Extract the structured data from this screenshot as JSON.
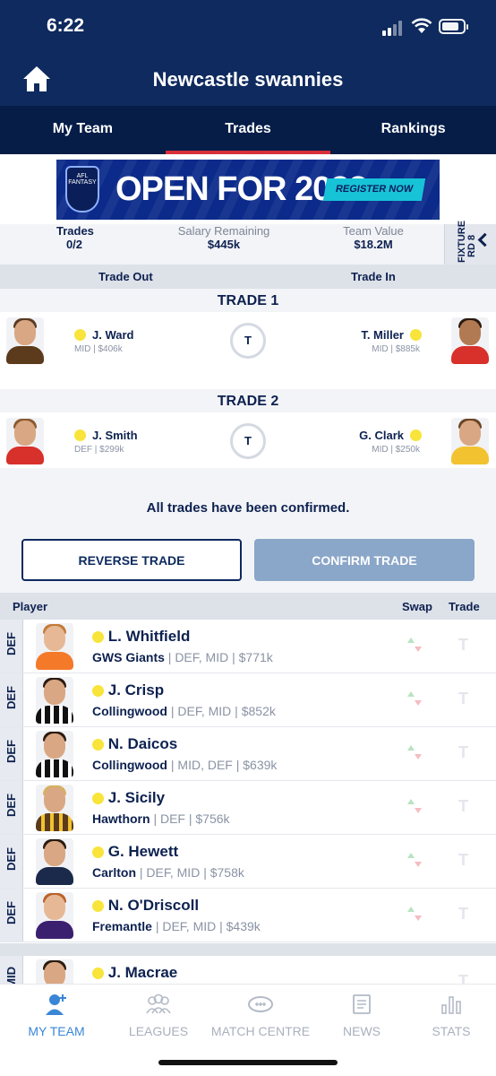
{
  "status_bar": {
    "time": "6:22"
  },
  "header": {
    "title": "Newcastle swannies"
  },
  "tabs": [
    {
      "label": "My Team"
    },
    {
      "label": "Trades"
    },
    {
      "label": "Rankings"
    }
  ],
  "banner": {
    "badge": "AFL FANTASY",
    "headline": "OPEN FOR 2022",
    "cta": "REGISTER NOW"
  },
  "summary": {
    "trades_label": "Trades",
    "trades_value": "0/2",
    "salary_label": "Salary Remaining",
    "salary_value": "$445k",
    "team_value_label": "Team Value",
    "team_value": "$18.2M",
    "fixture_label": "FIXTURE RD 8"
  },
  "trade_header": {
    "out": "Trade Out",
    "in": "Trade In"
  },
  "trades": [
    {
      "label": "TRADE 1",
      "out": {
        "name": "J. Ward",
        "meta": "MID | $406k"
      },
      "swap_label": "T",
      "in": {
        "name": "T. Miller",
        "meta": "MID | $885k"
      }
    },
    {
      "label": "TRADE 2",
      "out": {
        "name": "J. Smith",
        "meta": "DEF | $299k"
      },
      "swap_label": "T",
      "in": {
        "name": "G. Clark",
        "meta": "MID | $250k"
      }
    }
  ],
  "confirm_message": "All trades have been confirmed.",
  "buttons": {
    "reverse": "REVERSE TRADE",
    "confirm": "CONFIRM TRADE"
  },
  "list_header": {
    "player": "Player",
    "swap": "Swap",
    "trade": "Trade"
  },
  "players": [
    {
      "pos": "DEF",
      "name": "L. Whitfield",
      "team": "GWS Giants",
      "detail": "| DEF, MID | $771k",
      "trade": "T"
    },
    {
      "pos": "DEF",
      "name": "J. Crisp",
      "team": "Collingwood",
      "detail": "| DEF, MID | $852k",
      "trade": "T"
    },
    {
      "pos": "DEF",
      "name": "N. Daicos",
      "team": "Collingwood",
      "detail": "| MID, DEF | $639k",
      "trade": "T"
    },
    {
      "pos": "DEF",
      "name": "J. Sicily",
      "team": "Hawthorn",
      "detail": "| DEF | $756k",
      "trade": "T"
    },
    {
      "pos": "DEF",
      "name": "G. Hewett",
      "team": "Carlton",
      "detail": "| DEF, MID | $758k",
      "trade": "T"
    },
    {
      "pos": "DEF",
      "name": "N. O'Driscoll",
      "team": "Fremantle",
      "detail": "| DEF, MID | $439k",
      "trade": "T"
    },
    {
      "pos": "MID",
      "name": "J. Macrae",
      "team": "",
      "detail": "",
      "trade": "T"
    }
  ],
  "bottom_nav": [
    {
      "label": "MY TEAM",
      "icon": "user-plus-icon"
    },
    {
      "label": "LEAGUES",
      "icon": "group-icon"
    },
    {
      "label": "MATCH CENTRE",
      "icon": "football-icon"
    },
    {
      "label": "NEWS",
      "icon": "news-icon"
    },
    {
      "label": "STATS",
      "icon": "bar-chart-icon"
    }
  ],
  "colors": {
    "navy": "#0e2a5e",
    "accent_red": "#d8303a",
    "active_blue": "#3a86d6",
    "injury_dot": "#f8e43a"
  }
}
